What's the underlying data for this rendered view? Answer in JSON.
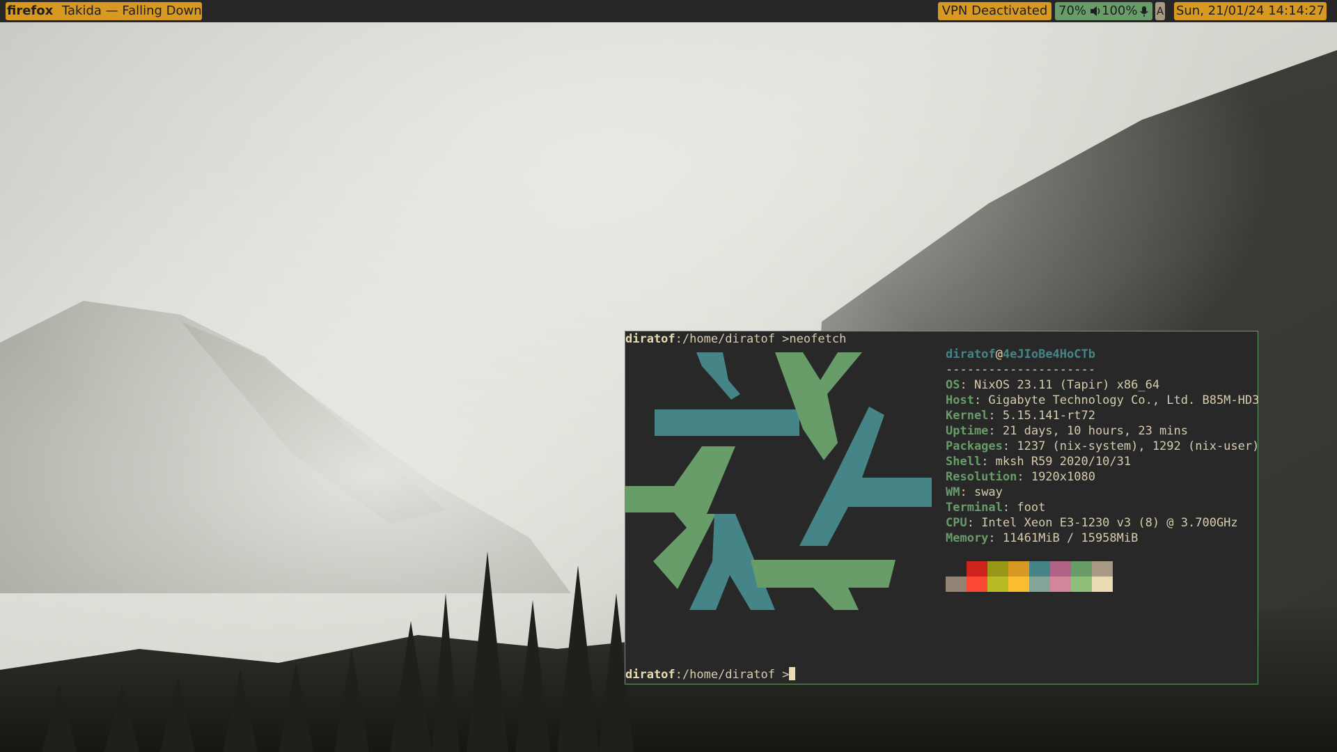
{
  "topbar": {
    "app_name": "firefox",
    "window_title": "Takida — Falling Down",
    "vpn": "VPN Deactivated",
    "volume": "70%",
    "battery": "100%",
    "keyboard": "A",
    "clock": "Sun, 21/01/24 14:14:27"
  },
  "terminal": {
    "prompt_user": "diratof",
    "prompt_path": ":/home/diratof >",
    "command": "neofetch",
    "user": "diratof",
    "at": "@",
    "host": "4eJIoBe4HoCTb",
    "separator": "---------------------",
    "info": [
      {
        "key": "OS",
        "value": ": NixOS 23.11 (Tapir) x86_64"
      },
      {
        "key": "Host",
        "value": ": Gigabyte Technology Co., Ltd. B85M-HD3"
      },
      {
        "key": "Kernel",
        "value": ": 5.15.141-rt72"
      },
      {
        "key": "Uptime",
        "value": ": 21 days, 10 hours, 23 mins"
      },
      {
        "key": "Packages",
        "value": ": 1237 (nix-system), 1292 (nix-user)"
      },
      {
        "key": "Shell",
        "value": ": mksh R59 2020/10/31"
      },
      {
        "key": "Resolution",
        "value": ": 1920x1080"
      },
      {
        "key": "WM",
        "value": ": sway"
      },
      {
        "key": "Terminal",
        "value": ": foot"
      },
      {
        "key": "CPU",
        "value": ": Intel Xeon E3-1230 v3 (8) @ 3.700GHz"
      },
      {
        "key": "Memory",
        "value": ": 11461MiB / 15958MiB"
      }
    ],
    "palette_dark": [
      "#282828",
      "#cc241d",
      "#98971a",
      "#d79921",
      "#458588",
      "#b16286",
      "#689d6a",
      "#a89984"
    ],
    "palette_bright": [
      "#928374",
      "#fb4934",
      "#b8bb26",
      "#fabd2f",
      "#83a598",
      "#d3869b",
      "#8ec07c",
      "#ebdbb2"
    ],
    "logo_colors": {
      "blue": "#458588",
      "green": "#689d6a"
    }
  },
  "icons": {
    "speaker": "speaker-icon",
    "microphone": "microphone-icon"
  }
}
